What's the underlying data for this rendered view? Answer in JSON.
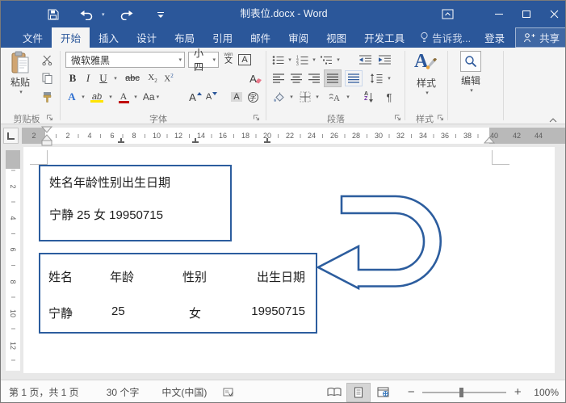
{
  "window": {
    "title": "制表位.docx - Word"
  },
  "tabs": {
    "items": [
      {
        "label": "文件"
      },
      {
        "label": "开始"
      },
      {
        "label": "插入"
      },
      {
        "label": "设计"
      },
      {
        "label": "布局"
      },
      {
        "label": "引用"
      },
      {
        "label": "邮件"
      },
      {
        "label": "审阅"
      },
      {
        "label": "视图"
      },
      {
        "label": "开发工具"
      }
    ],
    "active": "开始",
    "tell_me": "告诉我...",
    "sign_in": "登录",
    "share": "共享"
  },
  "ribbon": {
    "clipboard": {
      "label": "剪贴板",
      "paste_label": "粘贴"
    },
    "font": {
      "label": "字体",
      "name": "微软雅黑",
      "size": "小四",
      "pinyin_top": "wén",
      "pinyin_bottom": "文",
      "char_border": "A",
      "bold": "B",
      "italic": "I",
      "underline": "U",
      "strike": "abc",
      "sub_x": "X",
      "sub_n": "2",
      "sup_x": "X",
      "sup_n": "2",
      "clear": "A",
      "effects": "A",
      "highlight": "ab",
      "color": "A",
      "case": "Aa",
      "grow": "A",
      "shrink": "A",
      "shading": "A",
      "enclose": "字"
    },
    "paragraph": {
      "label": "段落",
      "marks": "¶",
      "sort_a": "A",
      "sort_z": "Z"
    },
    "styles": {
      "label": "样式",
      "button_label": "样式",
      "glyph": "A"
    },
    "editing": {
      "label": "编辑"
    }
  },
  "ruler": {
    "left_num": "2",
    "numbers": [
      "2",
      "4",
      "6",
      "8",
      "10",
      "12",
      "14",
      "16",
      "18",
      "20",
      "22",
      "24",
      "26",
      "28",
      "30",
      "32",
      "34",
      "36",
      "38"
    ],
    "right_numbers": [
      "40",
      "42",
      "44"
    ],
    "v_numbers": [
      "2",
      "4",
      "6",
      "8",
      "10",
      "12"
    ]
  },
  "document": {
    "box1": {
      "line1": "姓名年龄性别出生日期",
      "line2": "宁静 25 女 19950715"
    },
    "box2": {
      "headers": [
        "姓名",
        "年龄",
        "性别",
        "出生日期"
      ],
      "values": [
        "宁静",
        "25",
        "女",
        "19950715"
      ]
    }
  },
  "status": {
    "page_info": "第 1 页，共 1 页",
    "word_count": "30 个字",
    "language": "中文(中国)",
    "zoom_level": "100%"
  }
}
